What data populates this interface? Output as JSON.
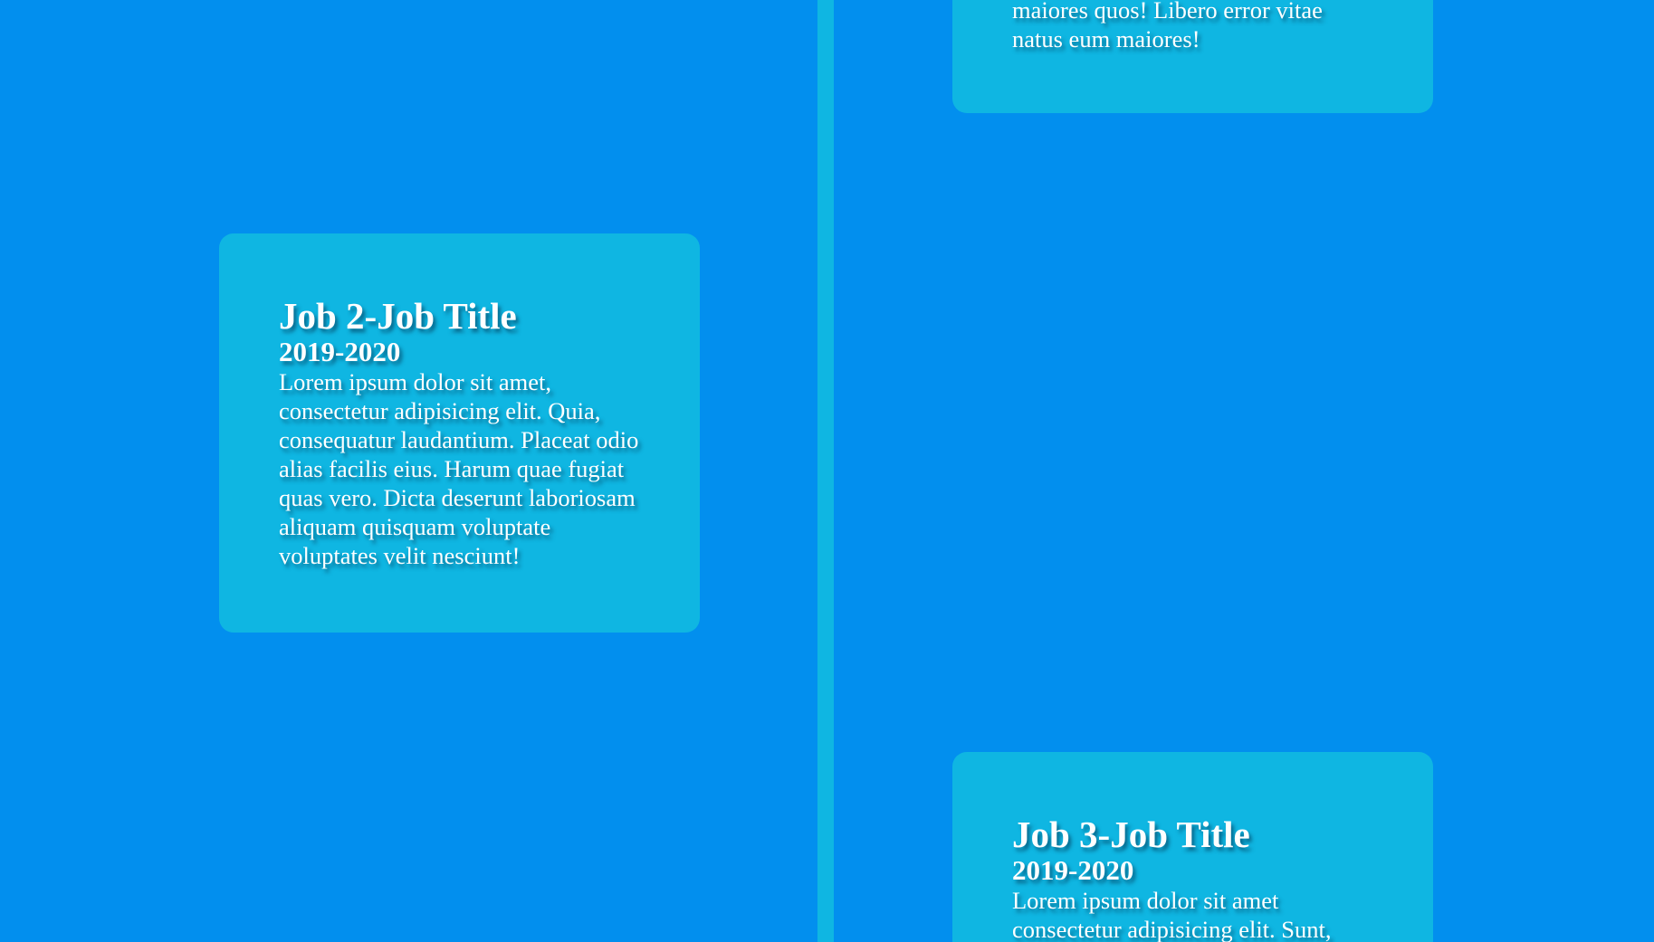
{
  "colors": {
    "background": "#028fee",
    "accent": "#0fb6e2",
    "text": "#ffffff"
  },
  "timeline": {
    "top_card": {
      "text": "maiores quos! Libero error vitae natus eum maiores!"
    },
    "job2": {
      "title": "Job 2-Job Title",
      "years": "2019-2020",
      "text": "Lorem ipsum dolor sit amet, consectetur adipisicing elit. Quia, consequatur laudantium. Placeat odio alias facilis eius. Harum quae fugiat quas vero. Dicta deserunt laboriosam aliquam quisquam voluptate voluptates velit nesciunt!"
    },
    "job3": {
      "title": "Job 3-Job Title",
      "years": "2019-2020",
      "text": "Lorem ipsum dolor sit amet consectetur adipisicing elit. Sunt,"
    }
  }
}
